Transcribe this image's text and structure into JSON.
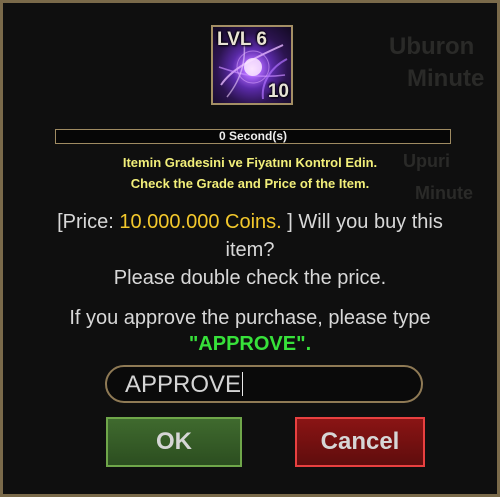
{
  "background_text": [
    "Uburon",
    "Minute",
    "Upuri",
    "Minute"
  ],
  "item": {
    "level_label": "LVL 6",
    "count": "10",
    "icon": "purple-vortex-orb-icon"
  },
  "timer": {
    "label": "0 Second(s)"
  },
  "notices": {
    "turkish": "Itemin Gradesini ve Fiyatını Kontrol Edin.",
    "english": "Check the Grade and Price of the Item."
  },
  "message": {
    "price_prefix": "[Price: ",
    "price_value": "10.000.000 Coins.",
    "price_suffix": " ] Will you buy this item?",
    "double_check": "Please double check the price."
  },
  "instruction": {
    "text": "If you approve the purchase, please type",
    "keyword": "\"APPROVE\"."
  },
  "input": {
    "value": "APPROVE"
  },
  "buttons": {
    "ok": "OK",
    "cancel": "Cancel"
  },
  "colors": {
    "price": "#f3c82c",
    "keyword": "#37e13a",
    "notice": "#f2ef7a",
    "ok_bg": "#3f6a2e",
    "cancel_bg": "#8a1414"
  }
}
